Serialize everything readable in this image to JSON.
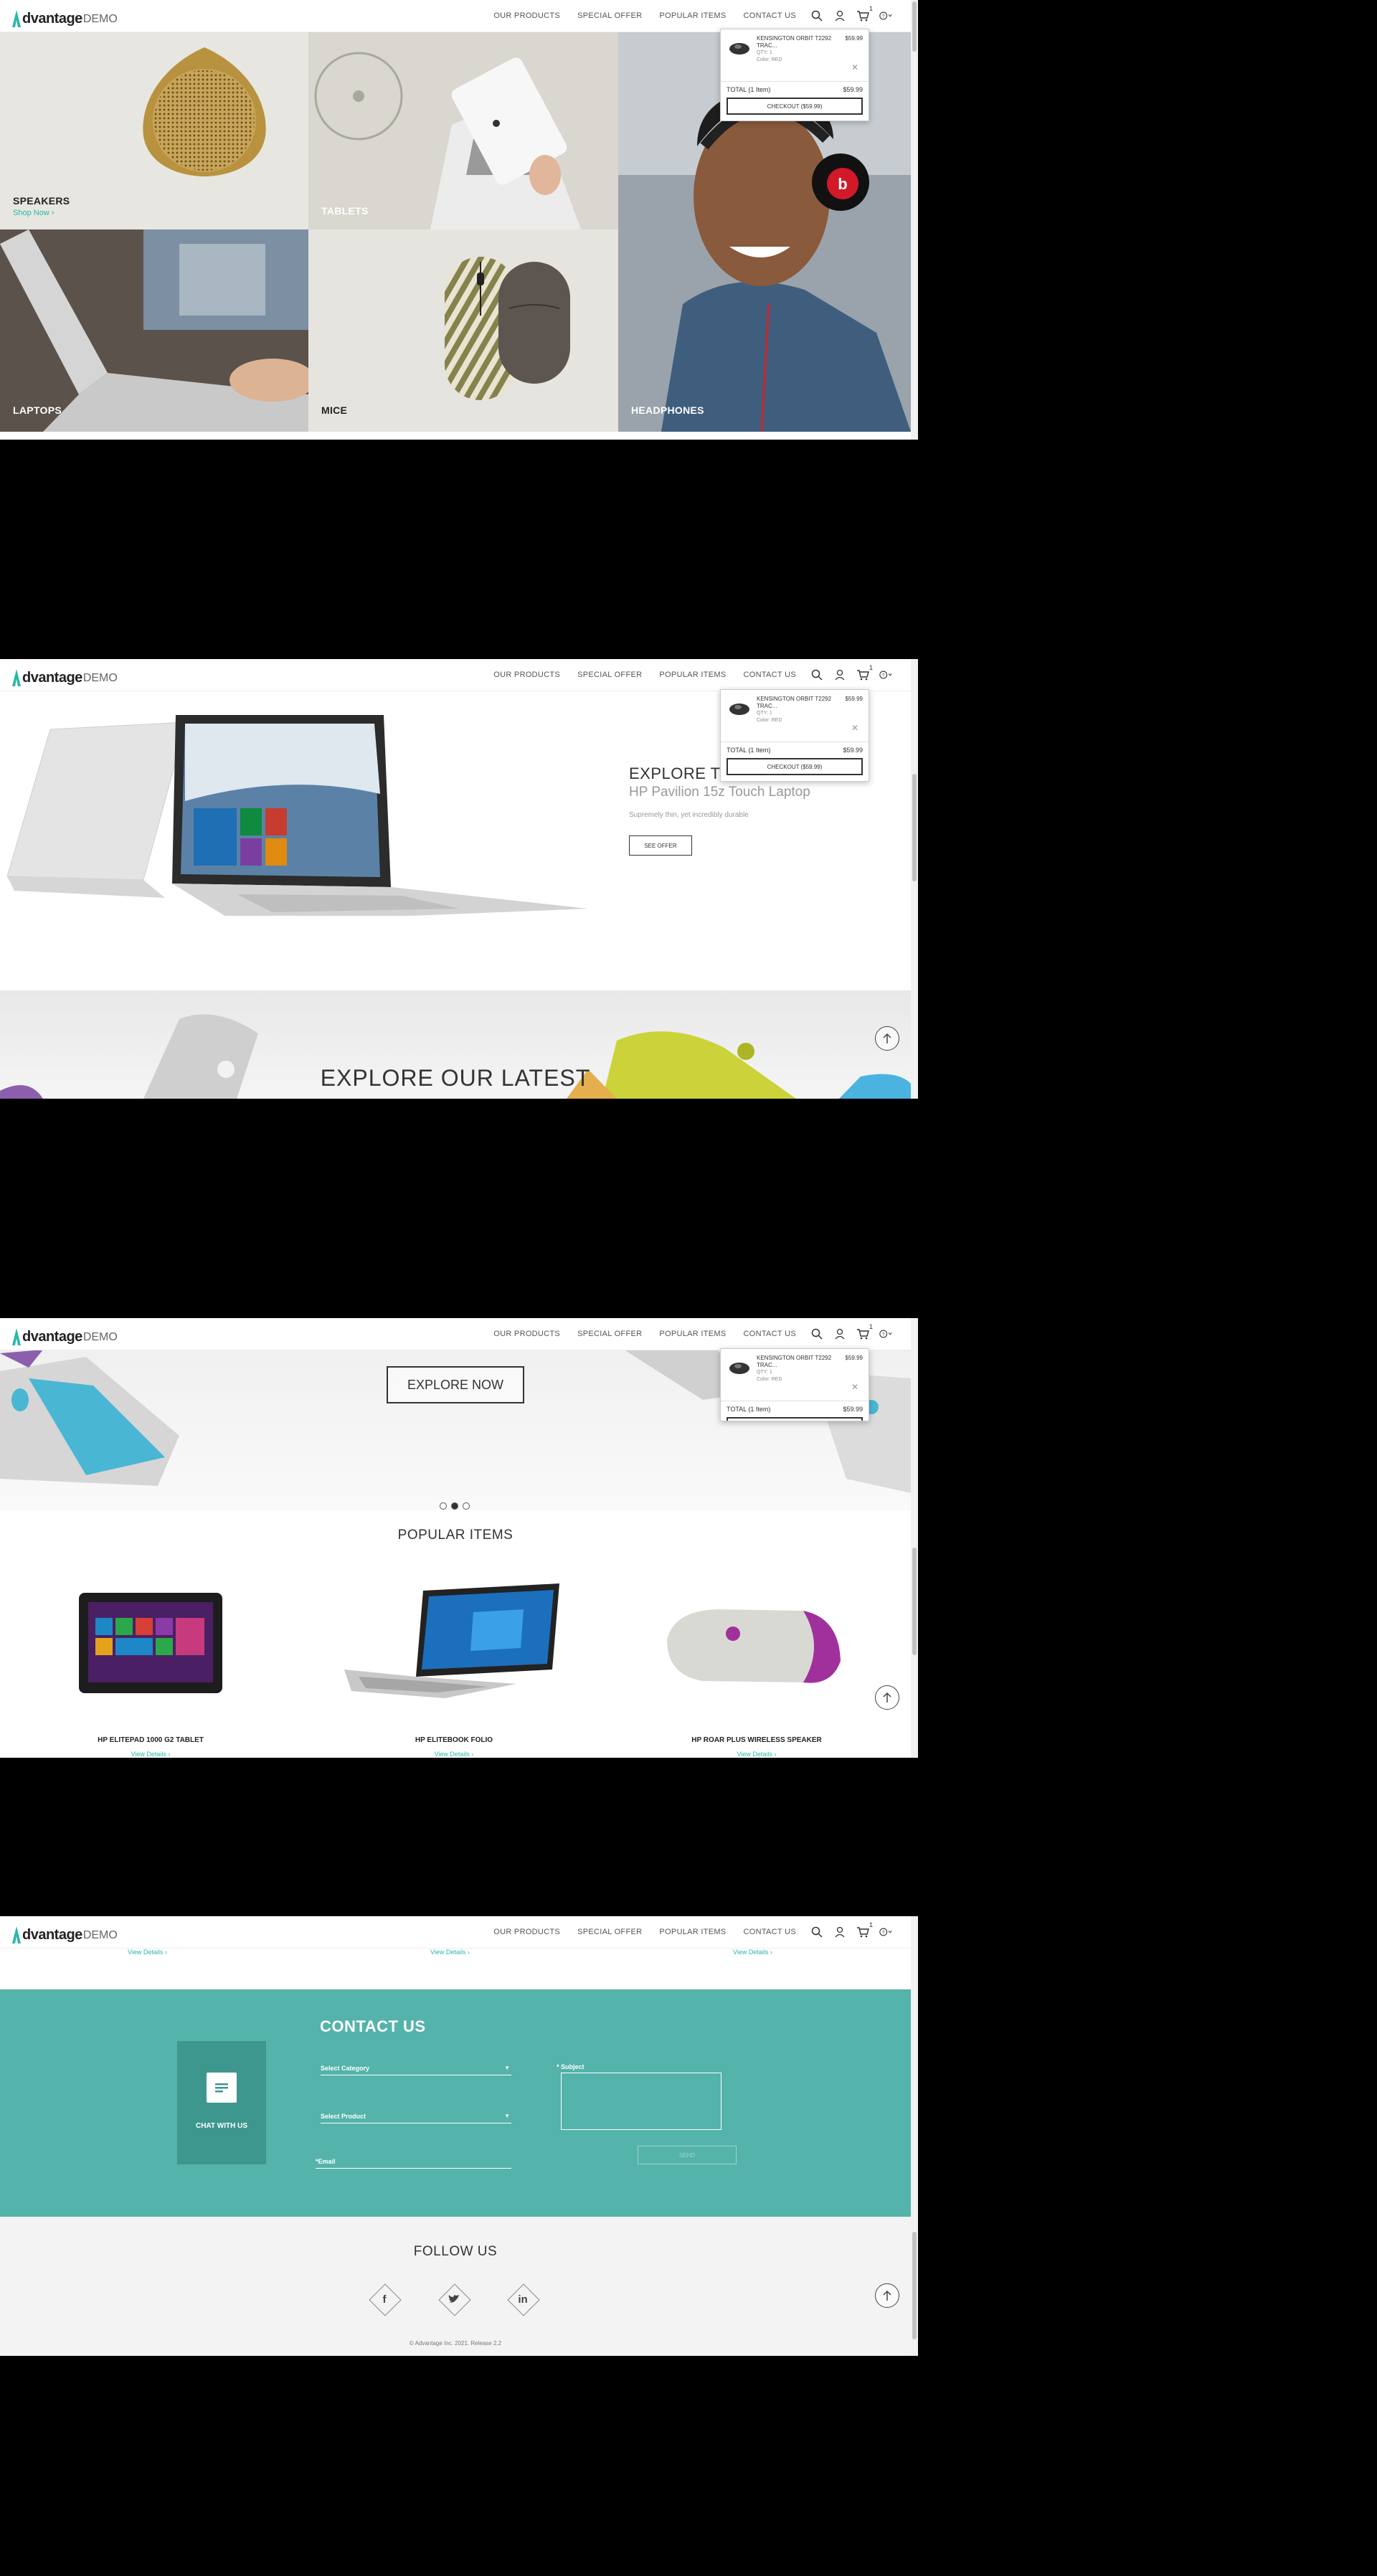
{
  "header": {
    "logo_word": "dvantage",
    "logo_demo": "DEMO",
    "nav": [
      "OUR PRODUCTS",
      "SPECIAL OFFER",
      "POPULAR ITEMS",
      "CONTACT US"
    ],
    "cart_count": "1"
  },
  "cart": {
    "item_name": "KENSINGTON ORBIT T2292 TRAC...",
    "item_qty": "QTY: 1",
    "item_color": "Color: RED",
    "item_price": "$59.99",
    "total_label": "TOTAL (1 Item)",
    "total_value": "$59.99",
    "checkout": "CHECKOUT ($59.99)"
  },
  "categories": {
    "speakers": "SPEAKERS",
    "shop_now": "Shop Now ›",
    "tablets": "TABLETS",
    "laptops": "LAPTOPS",
    "mice": "MICE",
    "headphones": "HEADPHONES"
  },
  "special_offer": {
    "title": "EXPLORE THE NEW",
    "subtitle": "HP Pavilion 15z Touch Laptop",
    "text": "Supremely thin, yet incredibly durable",
    "button": "SEE OFFER"
  },
  "promo": {
    "heading": "EXPLORE OUR LATEST",
    "button": "EXPLORE NOW"
  },
  "popular": {
    "title": "POPULAR ITEMS",
    "items": [
      {
        "name": "HP ELITEPAD 1000 G2 TABLET",
        "link": "View Details ›"
      },
      {
        "name": "HP ELITEBOOK FOLIO",
        "link": "View Details ›"
      },
      {
        "name": "HP ROAR PLUS WIRELESS SPEAKER",
        "link": "View Details ›"
      }
    ]
  },
  "contact": {
    "title": "CONTACT US",
    "chat": "CHAT WITH US",
    "category_placeholder": "Select Category",
    "product_placeholder": "Select Product",
    "email_label": "Email",
    "subject_label": "Subject",
    "send": "SEND"
  },
  "footer": {
    "follow": "FOLLOW US",
    "social": [
      "f",
      "t",
      "in"
    ],
    "copyright": "© Advantage Inc. 2021. Release 2.2"
  }
}
